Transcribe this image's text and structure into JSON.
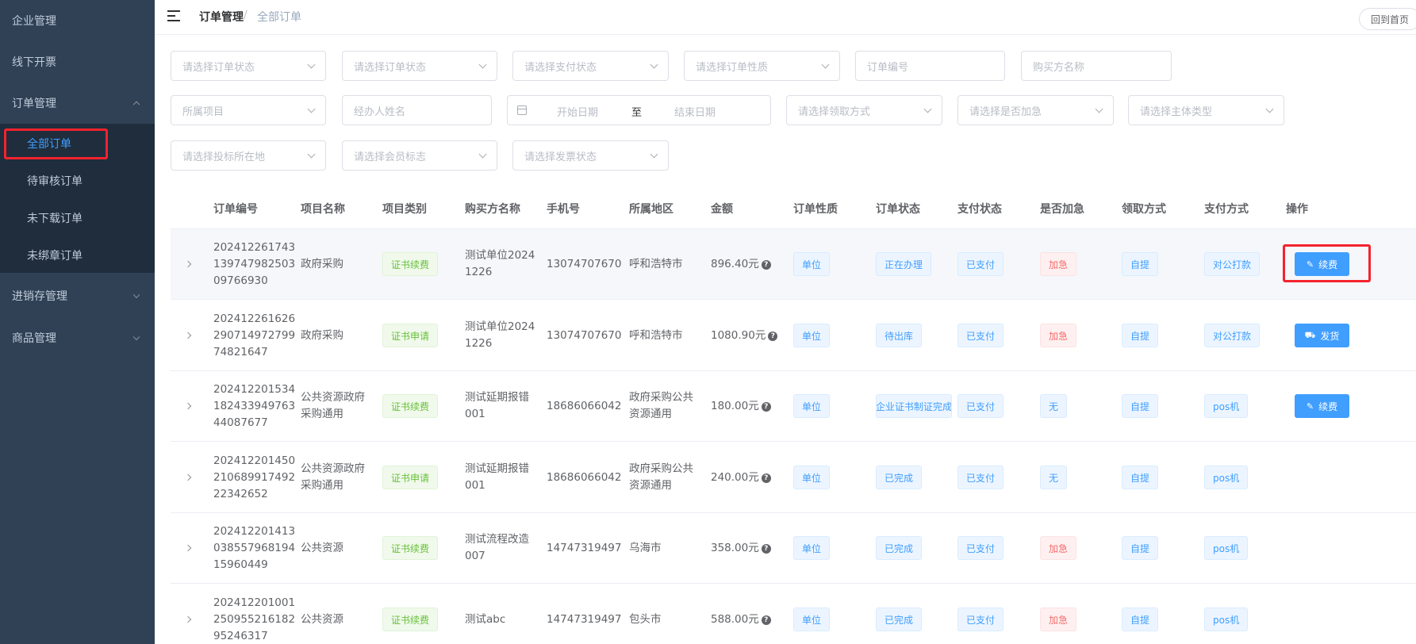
{
  "sidebar": {
    "items": [
      {
        "label": "企业管理"
      },
      {
        "label": "线下开票"
      },
      {
        "label": "订单管理"
      },
      {
        "label": "进销存管理"
      },
      {
        "label": "商品管理"
      }
    ],
    "submenu": [
      {
        "label": "全部订单",
        "active": true
      },
      {
        "label": "待审核订单"
      },
      {
        "label": "未下载订单"
      },
      {
        "label": "未绑章订单"
      }
    ]
  },
  "header": {
    "breadcrumb": [
      "订单管理",
      "全部订单"
    ],
    "separator": "/",
    "home_button": "回到首页"
  },
  "filters": {
    "order_status_1": "请选择订单状态",
    "order_status_2": "请选择订单状态",
    "pay_status": "请选择支付状态",
    "order_nature": "请选择订单性质",
    "order_no": "订单编号",
    "buyer_name": "购买方名称",
    "project": "所属项目",
    "agent_name": "经办人姓名",
    "start_date": "开始日期",
    "range_sep": "至",
    "end_date": "结束日期",
    "pickup_method": "请选择领取方式",
    "urgent": "请选择是否加急",
    "entity_type": "请选择主体类型",
    "bid_location": "请选择投标所在地",
    "member_flag": "请选择会员标志",
    "invoice_status": "请选择发票状态"
  },
  "table": {
    "columns": [
      "订单编号",
      "项目名称",
      "项目类别",
      "购买方名称",
      "手机号",
      "所属地区",
      "金额",
      "订单性质",
      "订单状态",
      "支付状态",
      "是否加急",
      "领取方式",
      "支付方式",
      "操作"
    ],
    "rows": [
      {
        "order_no": [
          "202412261743",
          "139747982503",
          "09766930"
        ],
        "project": [
          "政府采购"
        ],
        "category": "证书续费",
        "buyer": [
          "测试单位2024",
          "1226"
        ],
        "phone": "13074707670",
        "region": [
          "呼和浩特市"
        ],
        "amount": "896.40元",
        "nature": "单位",
        "status": "正在办理",
        "pay": "已支付",
        "urgent": "加急",
        "urgent_red": true,
        "pickup": "自提",
        "pay_method": "对公打款",
        "action": "续费",
        "action_icon": "edit-icon"
      },
      {
        "order_no": [
          "202412261626",
          "290714972799",
          "74821647"
        ],
        "project": [
          "政府采购"
        ],
        "category": "证书申请",
        "buyer": [
          "测试单位2024",
          "1226"
        ],
        "phone": "13074707670",
        "region": [
          "呼和浩特市"
        ],
        "amount": "1080.90元",
        "nature": "单位",
        "status": "待出库",
        "pay": "已支付",
        "urgent": "加急",
        "urgent_red": true,
        "pickup": "自提",
        "pay_method": "对公打款",
        "action": "发货",
        "action_icon": "truck-icon"
      },
      {
        "order_no": [
          "202412201534",
          "182433949763",
          "44087677"
        ],
        "project": [
          "公共资源政府",
          "采购通用"
        ],
        "category": "证书续费",
        "buyer": [
          "测试延期报错",
          "001"
        ],
        "phone": "18686066042",
        "region": [
          "政府采购公共",
          "资源通用"
        ],
        "amount": "180.00元",
        "nature": "单位",
        "status": "企业证书制证完成",
        "pay": "已支付",
        "urgent": "无",
        "urgent_red": false,
        "pickup": "自提",
        "pay_method": "pos机",
        "action": "续费",
        "action_icon": "edit-icon"
      },
      {
        "order_no": [
          "202412201450",
          "210689917492",
          "22342652"
        ],
        "project": [
          "公共资源政府",
          "采购通用"
        ],
        "category": "证书申请",
        "buyer": [
          "测试延期报错",
          "001"
        ],
        "phone": "18686066042",
        "region": [
          "政府采购公共",
          "资源通用"
        ],
        "amount": "240.00元",
        "nature": "单位",
        "status": "已完成",
        "pay": "已支付",
        "urgent": "无",
        "urgent_red": false,
        "pickup": "自提",
        "pay_method": "pos机",
        "action": "",
        "action_icon": ""
      },
      {
        "order_no": [
          "202412201413",
          "038557968194",
          "15960449"
        ],
        "project": [
          "公共资源"
        ],
        "category": "证书续费",
        "buyer": [
          "测试流程改造",
          "007"
        ],
        "phone": "14747319497",
        "region": [
          "乌海市"
        ],
        "amount": "358.00元",
        "nature": "单位",
        "status": "已完成",
        "pay": "已支付",
        "urgent": "加急",
        "urgent_red": true,
        "pickup": "自提",
        "pay_method": "pos机",
        "action": "",
        "action_icon": ""
      },
      {
        "order_no": [
          "202412201001",
          "250955216182",
          "95246317"
        ],
        "project": [
          "公共资源"
        ],
        "category": "证书续费",
        "buyer": [
          "测试abc"
        ],
        "phone": "14747319497",
        "region": [
          "包头市"
        ],
        "amount": "588.00元",
        "nature": "单位",
        "status": "已完成",
        "pay": "已支付",
        "urgent": "加急",
        "urgent_red": true,
        "pickup": "自提",
        "pay_method": "pos机",
        "action": "",
        "action_icon": ""
      }
    ]
  },
  "colors": {
    "sidebar_bg": "#304156",
    "submenu_bg": "#1f2d3d",
    "primary": "#409eff",
    "highlight": "#f5222d"
  }
}
